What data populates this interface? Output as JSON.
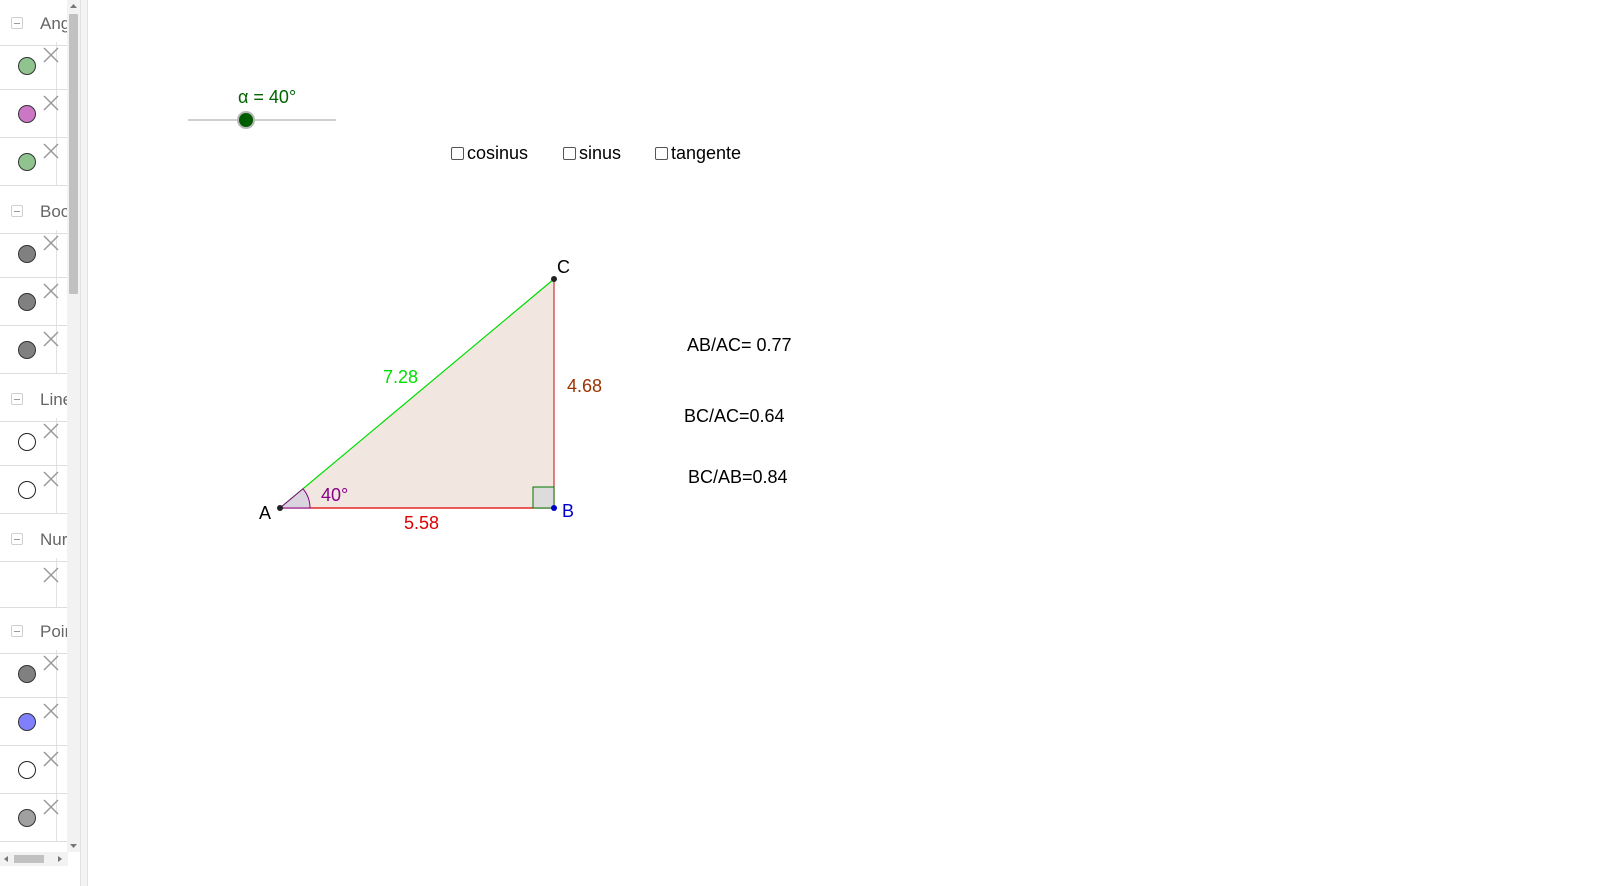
{
  "sidebar": {
    "groups": [
      {
        "label": "Ang",
        "items": [
          {
            "color": "#8fc48f"
          },
          {
            "color": "#cc77c6"
          },
          {
            "color": "#8fc48f"
          }
        ]
      },
      {
        "label": "Boc",
        "items": [
          {
            "color": "#808080"
          },
          {
            "color": "#808080"
          },
          {
            "color": "#808080"
          }
        ]
      },
      {
        "label": "Line",
        "items": [
          {
            "color": "#ffffff"
          },
          {
            "color": "#ffffff"
          }
        ]
      },
      {
        "label": "Nur",
        "items": [
          {
            "color": ""
          }
        ]
      },
      {
        "label": "Poir",
        "items": [
          {
            "color": "#808080"
          },
          {
            "color": "#8080ff"
          },
          {
            "color": "#ffffff"
          },
          {
            "color": "#a0a0a0"
          }
        ]
      }
    ]
  },
  "slider": {
    "label": "α = 40°",
    "value_deg": 40,
    "color": "#006400"
  },
  "checkboxes": [
    {
      "label": "cosinus",
      "checked": false
    },
    {
      "label": "sinus",
      "checked": false
    },
    {
      "label": "tangente",
      "checked": false
    }
  ],
  "triangle": {
    "points": {
      "A": "A",
      "B": "B",
      "C": "C"
    },
    "colors": {
      "A": "#000000",
      "B": "#0000cc",
      "C": "#000000"
    },
    "sides": {
      "AB": {
        "label": "5.58",
        "color": "#dd0000"
      },
      "BC": {
        "label": "4.68",
        "color": "#993300"
      },
      "AC": {
        "label": "7.28",
        "color": "#00dd00"
      }
    },
    "angle_label": "40°",
    "angle_color": "#880088",
    "fill_color": "#f2e6e0"
  },
  "ratios": {
    "ab_ac": "AB/AC= 0.77",
    "bc_ac": "BC/AC=0.64",
    "bc_ab": "BC/AB=0.84"
  }
}
